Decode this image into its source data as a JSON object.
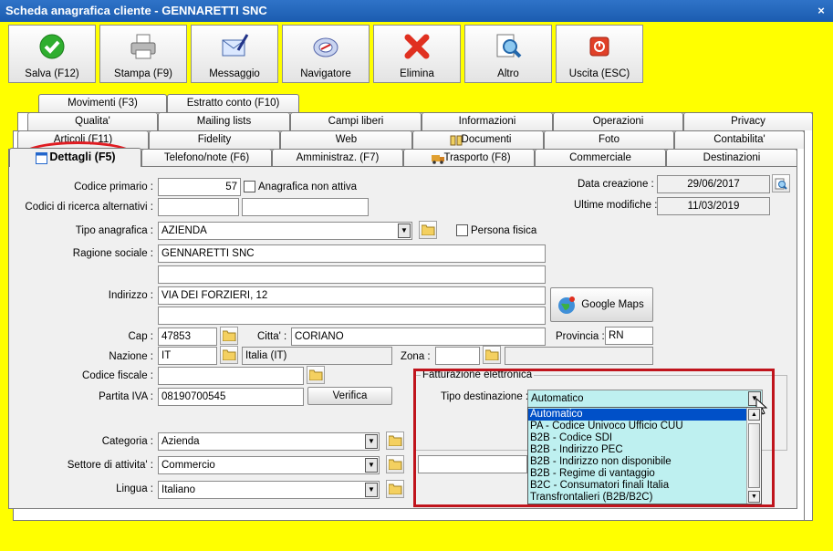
{
  "window": {
    "title": "Scheda anagrafica cliente - GENNARETTI SNC",
    "close_label": "×"
  },
  "toolbar": [
    {
      "label": "Salva (F12)",
      "icon": "check-icon"
    },
    {
      "label": "Stampa (F9)",
      "icon": "printer-icon"
    },
    {
      "label": "Messaggio",
      "icon": "message-icon"
    },
    {
      "label": "Navigatore",
      "icon": "compass-icon"
    },
    {
      "label": "Elimina",
      "icon": "delete-x-icon"
    },
    {
      "label": "Altro",
      "icon": "search-doc-icon"
    },
    {
      "label": "Uscita (ESC)",
      "icon": "power-icon"
    }
  ],
  "tabs": {
    "row1": [
      "Movimenti (F3)",
      "Estratto conto (F10)"
    ],
    "row2": [
      "Qualita'",
      "Mailing lists",
      "Campi liberi",
      "Informazioni",
      "Operazioni",
      "Privacy"
    ],
    "row3": [
      "Articoli (F11)",
      "Fidelity",
      "Web",
      "Documenti",
      "Foto",
      "Contabilita'"
    ],
    "row4": [
      "Dettagli (F5)",
      "Telefono/note (F6)",
      "Amministraz. (F7)",
      "Trasporto (F8)",
      "Commerciale",
      "Destinazioni"
    ]
  },
  "form": {
    "codice_primario_label": "Codice primario :",
    "codice_primario": "57",
    "non_attiva_label": "Anagrafica non attiva",
    "codici_ricerca_label": "Codici di ricerca alternativi :",
    "tipo_label": "Tipo anagrafica :",
    "tipo": "AZIENDA",
    "persona_fisica_label": "Persona fisica",
    "ragione_label": "Ragione sociale :",
    "ragione": "GENNARETTI SNC",
    "indirizzo_label": "Indirizzo :",
    "indirizzo": "VIA DEI FORZIERI, 12",
    "google_maps_label": "Google Maps",
    "cap_label": "Cap :",
    "cap": "47853",
    "citta_label": "Citta' :",
    "citta": "CORIANO",
    "provincia_label": "Provincia :",
    "provincia": "RN",
    "nazione_label": "Nazione :",
    "nazione": "IT",
    "nazione_desc": "Italia (IT)",
    "zona_label": "Zona :",
    "codice_fiscale_label": "Codice fiscale :",
    "piva_label": "Partita IVA :",
    "piva": "08190700545",
    "verifica_label": "Verifica",
    "categoria_label": "Categoria :",
    "categoria": "Azienda",
    "settore_label": "Settore di attivita' :",
    "settore": "Commercio",
    "lingua_label": "Lingua :",
    "lingua": "Italiano",
    "data_creazione_label": "Data creazione :",
    "data_creazione": "29/06/2017",
    "ultime_modifiche_label": "Ultime modifiche :",
    "ultime_modifiche": "11/03/2019"
  },
  "fatturazione": {
    "group_label": "Fatturazione elettronica",
    "tipo_destinazione_label": "Tipo destinazione :",
    "selected": "Automatico",
    "options": [
      "Automatico",
      "PA - Codice Univoco Ufficio CUU",
      "B2B - Codice SDI",
      "B2B - Indirizzo PEC",
      "B2B - Indirizzo non disponibile",
      "B2B - Regime di vantaggio",
      "B2C - Consumatori finali Italia",
      "Transfrontalieri (B2B/B2C)"
    ]
  },
  "colors": {
    "background": "#ffff00",
    "title_bar": "#1f63b8",
    "highlight_red": "#c0141c",
    "dropdown_bg": "#bef0f0",
    "selected_option": "#0050c8"
  }
}
